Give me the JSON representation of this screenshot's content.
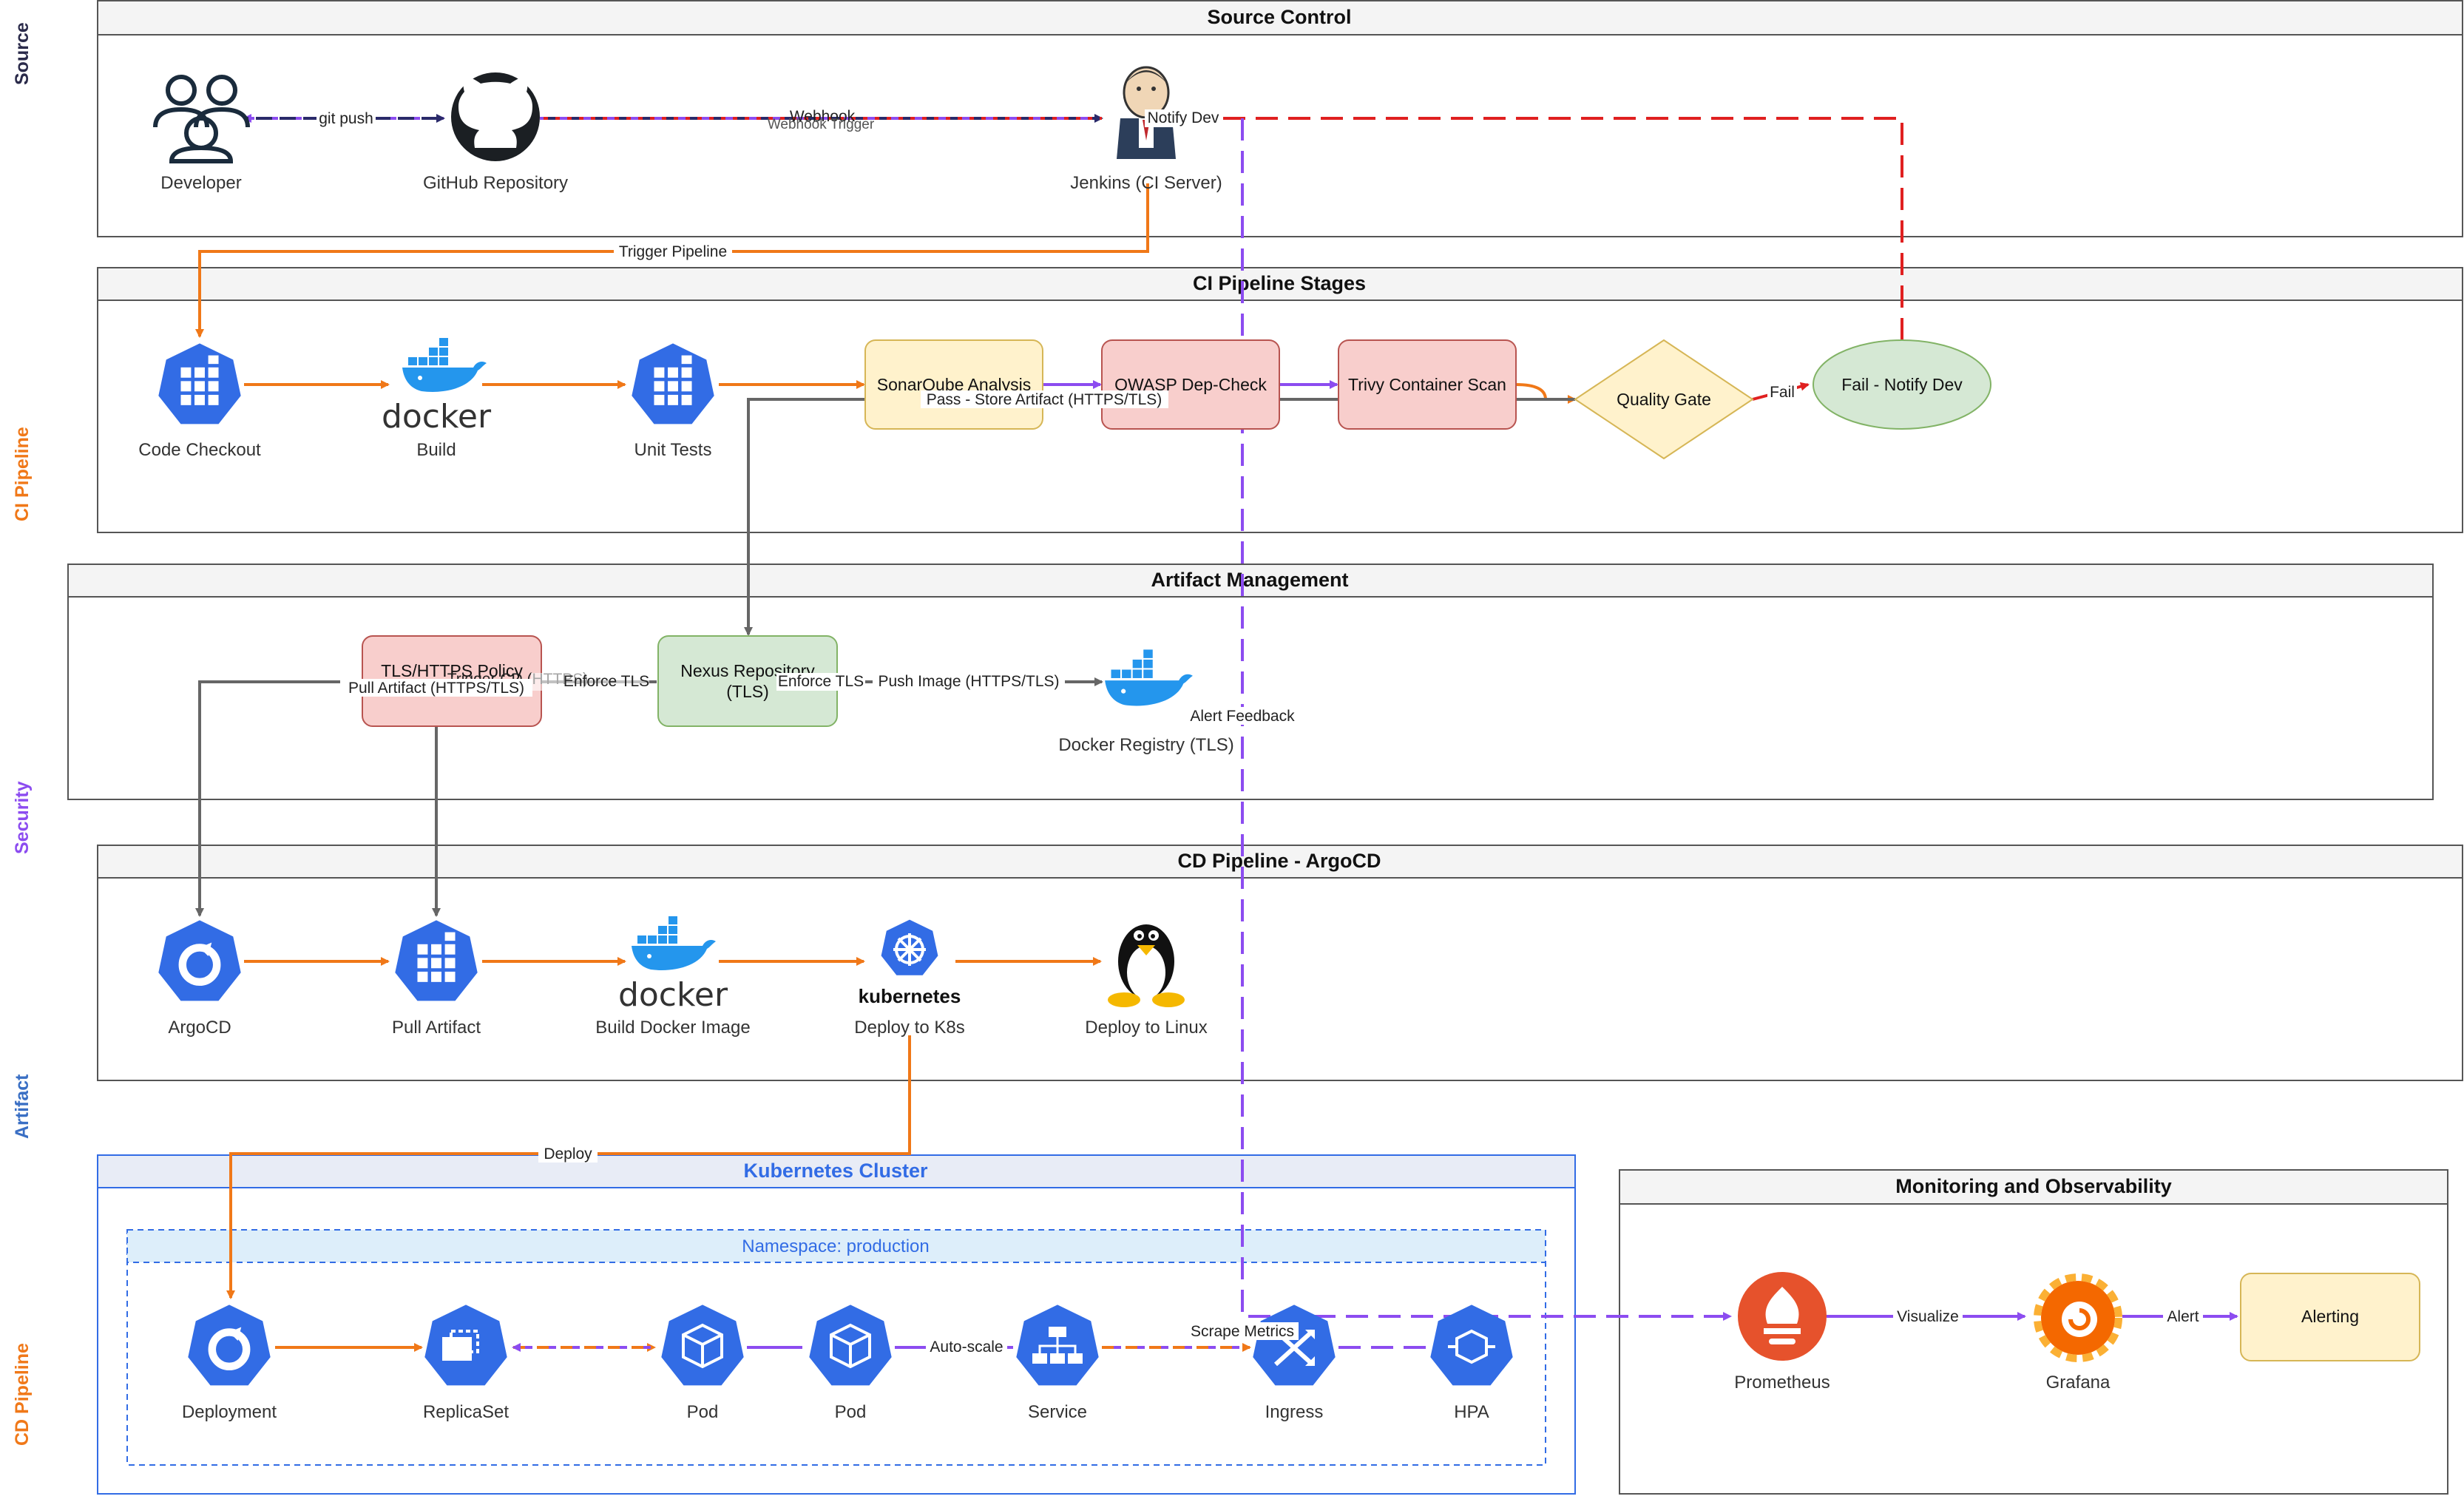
{
  "side_labels": {
    "source": "Source",
    "ci": "CI Pipeline",
    "security": "Security",
    "artifact": "Artifact",
    "cd": "CD Pipeline"
  },
  "lanes": {
    "source_control": "Source Control",
    "ci_stages": "CI Pipeline Stages",
    "artifact_mgmt": "Artifact Management",
    "cd_argocd": "CD Pipeline - ArgoCD",
    "k8s_cluster": "Kubernetes Cluster",
    "namespace": "Namespace: production",
    "monitoring": "Monitoring and Observability"
  },
  "nodes": {
    "developer": "Developer",
    "github": "GitHub Repository",
    "jenkins": "Jenkins (CI Server)",
    "code_checkout": "Code Checkout",
    "build": "Build",
    "unit_tests": "Unit Tests",
    "sonarqube": "SonarQube Analysis",
    "owasp": "OWASP Dep-Check",
    "trivy": "Trivy Container Scan",
    "quality_gate": "Quality Gate",
    "fail_notify": "Fail - Notify Dev",
    "tls_policy": "TLS/HTTPS Policy",
    "nexus_line1": "Nexus Repository",
    "nexus_line2": "(TLS)",
    "docker_registry": "Docker Registry (TLS)",
    "argocd": "ArgoCD",
    "pull_artifact": "Pull Artifact",
    "build_docker_image": "Build Docker Image",
    "deploy_k8s": "Deploy to K8s",
    "deploy_linux": "Deploy to Linux",
    "deployment": "Deployment",
    "replicaset": "ReplicaSet",
    "pod1": "Pod",
    "pod2": "Pod",
    "service": "Service",
    "ingress": "Ingress",
    "hpa": "HPA",
    "prometheus": "Prometheus",
    "grafana": "Grafana",
    "alerting": "Alerting",
    "docker_word": "docker",
    "kubernetes_word": "kubernetes"
  },
  "edges": {
    "git_push": "git push",
    "webhook": "Webhook",
    "webhook_trigger": "Webhook Trigger",
    "notify_dev": "Notify Dev",
    "trigger_pipeline": "Trigger Pipeline",
    "fail": "Fail",
    "pass_store": "Pass - Store Artifact (HTTPS/TLS)",
    "trigger_cd": "Trigger CD (HTTPS)",
    "enforce_tls_1": "Enforce TLS",
    "enforce_tls_2": "Enforce TLS",
    "push_image": "Push Image (HTTPS/TLS)",
    "pull_artifact_tls": "Pull Artifact (HTTPS/TLS)",
    "alert_feedback": "Alert Feedback",
    "deploy": "Deploy",
    "auto_scale": "Auto-scale",
    "scrape_metrics": "Scrape Metrics",
    "visualize": "Visualize",
    "alert": "Alert"
  },
  "colors": {
    "orange": "#f07818",
    "purple": "#8c4cf0",
    "red": "#e02020",
    "gray": "#666666",
    "navy": "#2a2a6a",
    "k8s_blue": "#326ce5",
    "side_ci": "#f07818",
    "side_security": "#8c4cf0",
    "side_artifact": "#3a6fc4"
  },
  "icons": {
    "developer": "users-icon",
    "github": "github-icon",
    "jenkins": "jenkins-icon",
    "code_checkout": "k8s-grid-icon",
    "build": "docker-whale-icon",
    "unit_tests": "k8s-grid-icon",
    "docker_registry": "docker-whale-icon",
    "argocd": "argocd-icon",
    "pull_artifact": "k8s-grid-icon",
    "build_docker_image": "docker-whale-icon",
    "deploy_k8s": "kubernetes-helm-icon",
    "deploy_linux": "tux-penguin-icon",
    "deployment": "k8s-deploy-icon",
    "replicaset": "k8s-replicaset-icon",
    "pod": "k8s-pod-icon",
    "service": "k8s-service-icon",
    "ingress": "k8s-ingress-icon",
    "hpa": "k8s-hpa-icon",
    "prometheus": "prometheus-icon",
    "grafana": "grafana-icon"
  }
}
